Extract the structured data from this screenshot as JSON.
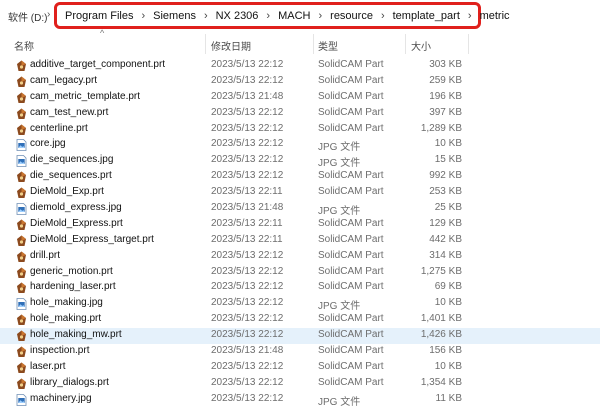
{
  "address_bar": {
    "drive": "软件 (D:)",
    "separator": "›",
    "segments": [
      "Program Files",
      "Siemens",
      "NX 2306",
      "MACH",
      "resource",
      "template_part",
      "metric"
    ],
    "highlight_color": "#e0201c"
  },
  "columns": {
    "name": "名称",
    "date": "修改日期",
    "type": "类型",
    "size": "大小"
  },
  "sort_indicator": "^",
  "files": [
    {
      "name": "additive_target_component.prt",
      "date": "2023/5/13 22:12",
      "type": "SolidCAM Part",
      "size": "303 KB",
      "icon": "solidcam-part-icon"
    },
    {
      "name": "cam_legacy.prt",
      "date": "2023/5/13 22:12",
      "type": "SolidCAM Part",
      "size": "259 KB",
      "icon": "solidcam-part-icon"
    },
    {
      "name": "cam_metric_template.prt",
      "date": "2023/5/13 21:48",
      "type": "SolidCAM Part",
      "size": "196 KB",
      "icon": "solidcam-part-icon"
    },
    {
      "name": "cam_test_new.prt",
      "date": "2023/5/13 22:12",
      "type": "SolidCAM Part",
      "size": "397 KB",
      "icon": "solidcam-part-icon"
    },
    {
      "name": "centerline.prt",
      "date": "2023/5/13 22:12",
      "type": "SolidCAM Part",
      "size": "1,289 KB",
      "icon": "solidcam-part-icon"
    },
    {
      "name": "core.jpg",
      "date": "2023/5/13 22:12",
      "type": "JPG 文件",
      "size": "10 KB",
      "icon": "jpg-file-icon"
    },
    {
      "name": "die_sequences.jpg",
      "date": "2023/5/13 22:12",
      "type": "JPG 文件",
      "size": "15 KB",
      "icon": "jpg-file-icon"
    },
    {
      "name": "die_sequences.prt",
      "date": "2023/5/13 22:12",
      "type": "SolidCAM Part",
      "size": "992 KB",
      "icon": "solidcam-part-icon"
    },
    {
      "name": "DieMold_Exp.prt",
      "date": "2023/5/13 22:11",
      "type": "SolidCAM Part",
      "size": "253 KB",
      "icon": "solidcam-part-icon"
    },
    {
      "name": "diemold_express.jpg",
      "date": "2023/5/13 21:48",
      "type": "JPG 文件",
      "size": "25 KB",
      "icon": "jpg-file-icon"
    },
    {
      "name": "DieMold_Express.prt",
      "date": "2023/5/13 22:11",
      "type": "SolidCAM Part",
      "size": "129 KB",
      "icon": "solidcam-part-icon"
    },
    {
      "name": "DieMold_Express_target.prt",
      "date": "2023/5/13 22:11",
      "type": "SolidCAM Part",
      "size": "442 KB",
      "icon": "solidcam-part-icon"
    },
    {
      "name": "drill.prt",
      "date": "2023/5/13 22:12",
      "type": "SolidCAM Part",
      "size": "314 KB",
      "icon": "solidcam-part-icon"
    },
    {
      "name": "generic_motion.prt",
      "date": "2023/5/13 22:12",
      "type": "SolidCAM Part",
      "size": "1,275 KB",
      "icon": "solidcam-part-icon"
    },
    {
      "name": "hardening_laser.prt",
      "date": "2023/5/13 22:12",
      "type": "SolidCAM Part",
      "size": "69 KB",
      "icon": "solidcam-part-icon"
    },
    {
      "name": "hole_making.jpg",
      "date": "2023/5/13 22:12",
      "type": "JPG 文件",
      "size": "10 KB",
      "icon": "jpg-file-icon"
    },
    {
      "name": "hole_making.prt",
      "date": "2023/5/13 22:12",
      "type": "SolidCAM Part",
      "size": "1,401 KB",
      "icon": "solidcam-part-icon"
    },
    {
      "name": "hole_making_mw.prt",
      "date": "2023/5/13 22:12",
      "type": "SolidCAM Part",
      "size": "1,426 KB",
      "icon": "solidcam-part-icon",
      "selected": true
    },
    {
      "name": "inspection.prt",
      "date": "2023/5/13 21:48",
      "type": "SolidCAM Part",
      "size": "156 KB",
      "icon": "solidcam-part-icon"
    },
    {
      "name": "laser.prt",
      "date": "2023/5/13 22:12",
      "type": "SolidCAM Part",
      "size": "10 KB",
      "icon": "solidcam-part-icon"
    },
    {
      "name": "library_dialogs.prt",
      "date": "2023/5/13 22:12",
      "type": "SolidCAM Part",
      "size": "1,354 KB",
      "icon": "solidcam-part-icon"
    },
    {
      "name": "machinery.jpg",
      "date": "2023/5/13 22:12",
      "type": "JPG 文件",
      "size": "11 KB",
      "icon": "jpg-file-icon"
    }
  ]
}
